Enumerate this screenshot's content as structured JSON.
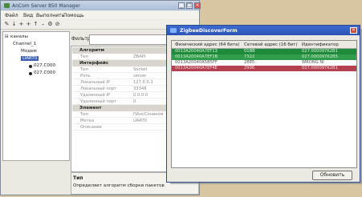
{
  "main_window": {
    "title": "AnCom Server 850 Manager",
    "menu": [
      "Файл",
      "Вид",
      "Выполнить",
      "Помощь"
    ],
    "toolbar_icons": [
      "plus-icon",
      "arrow-down-icon",
      "plus-icon",
      "plus-icon",
      "arrow-up-icon",
      "gear-icon",
      "stop-icon"
    ],
    "tree": [
      {
        "label": "каналы",
        "level": 0
      },
      {
        "label": "Channel_1",
        "level": 1
      },
      {
        "label": "Модем",
        "level": 2
      },
      {
        "label": "UART0",
        "level": 2,
        "selected": true
      },
      {
        "label": "027.C000",
        "level": 3
      },
      {
        "label": "027.C000",
        "level": 3
      }
    ],
    "filter_label": "Фильтр:",
    "filter_value": "",
    "properties": {
      "categories": [
        {
          "name": "Алгоритм",
          "rows": [
            {
              "key": "Тип",
              "value": "ZBAPI"
            }
          ]
        },
        {
          "name": "Интерфейс",
          "rows": [
            {
              "key": "Тип",
              "value": "Socket"
            },
            {
              "key": "Роль",
              "value": "server"
            },
            {
              "key": "Локальный IP",
              "value": "127.0.0.1"
            },
            {
              "key": "Локальный порт",
              "value": "33348"
            },
            {
              "key": "Удаленный IP",
              "value": "0.0.0.0"
            },
            {
              "key": "Удаленный порт",
              "value": "0"
            }
          ]
        },
        {
          "name": "Элемент",
          "rows": [
            {
              "key": "Тип",
              "value": "ПАнсСоником"
            },
            {
              "key": "Метка",
              "value": "UART0"
            },
            {
              "key": "Описание",
              "value": ""
            }
          ]
        }
      ]
    },
    "description": {
      "title": "Тип",
      "text": "Определяет алгоритм сборки пакетов"
    }
  },
  "dialog": {
    "title": "ZigbeeDiscoverForm",
    "columns": [
      "Физический адрес (64 бита)",
      "Сетевой адрес (16 бит)",
      "Идентификатор"
    ],
    "rows": [
      {
        "phys": "0013A20040A7EF13",
        "net": "01BB",
        "id": "027.000097K2B1",
        "status": "green"
      },
      {
        "phys": "0013A20040A7EF1B",
        "net": "7322",
        "id": "027.000097K2B5",
        "status": "green"
      },
      {
        "phys": "0013A20040A5B5FF",
        "net": "2885",
        "id": "WRONG NI",
        "status": "none"
      },
      {
        "phys": "0013A20040A7EF4E",
        "net": "2996",
        "id": "027.000097K2B1",
        "status": "red"
      }
    ],
    "refresh_button": "Обновить"
  }
}
